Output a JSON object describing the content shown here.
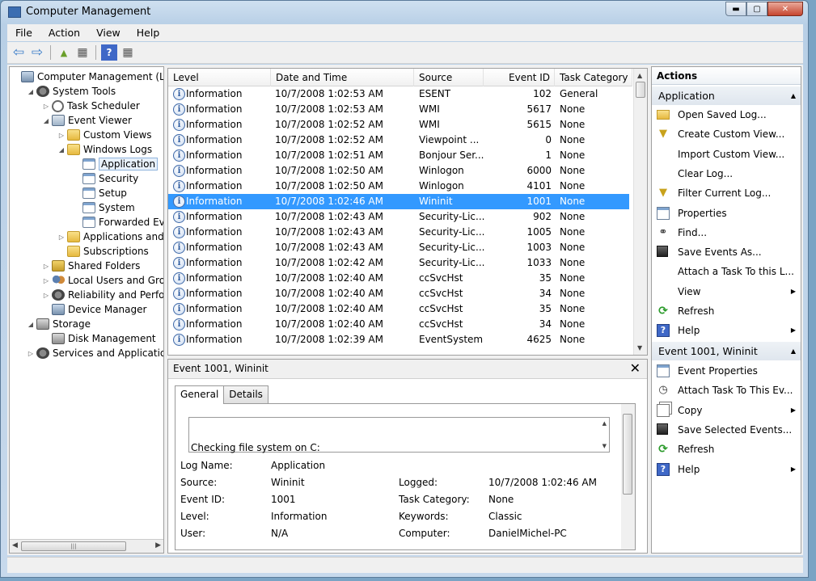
{
  "window": {
    "title": "Computer Management"
  },
  "menu": [
    "File",
    "Action",
    "View",
    "Help"
  ],
  "toolbar": [
    {
      "icon": "back-arrow-icon",
      "glyph": "⇦"
    },
    {
      "icon": "forward-arrow-icon",
      "glyph": "⇨"
    },
    {
      "icon": "up-folder-icon",
      "glyph": "▲"
    },
    {
      "icon": "show-hide-tree-icon",
      "glyph": "▦"
    },
    {
      "icon": "help-icon",
      "glyph": "?"
    },
    {
      "icon": "show-hide-action-pane-icon",
      "glyph": "▦"
    }
  ],
  "tree": [
    {
      "label": "Computer Management (Local)",
      "indent": 0,
      "exp": "",
      "icon": "comp",
      "icon_name": "computer-management-icon"
    },
    {
      "label": "System Tools",
      "indent": 1,
      "exp": "◢",
      "icon": "gear",
      "icon_name": "system-tools-icon"
    },
    {
      "label": "Task Scheduler",
      "indent": 2,
      "exp": "▷",
      "icon": "clock",
      "icon_name": "task-scheduler-icon"
    },
    {
      "label": "Event Viewer",
      "indent": 2,
      "exp": "◢",
      "icon": "event",
      "icon_name": "event-viewer-icon"
    },
    {
      "label": "Custom Views",
      "indent": 3,
      "exp": "▷",
      "icon": "folder",
      "icon_name": "folder-icon"
    },
    {
      "label": "Windows Logs",
      "indent": 3,
      "exp": "◢",
      "icon": "folder",
      "icon_name": "folder-icon"
    },
    {
      "label": "Application",
      "indent": 4,
      "exp": "",
      "icon": "log",
      "icon_name": "log-icon",
      "selected": true
    },
    {
      "label": "Security",
      "indent": 4,
      "exp": "",
      "icon": "log",
      "icon_name": "log-icon"
    },
    {
      "label": "Setup",
      "indent": 4,
      "exp": "",
      "icon": "log",
      "icon_name": "log-icon"
    },
    {
      "label": "System",
      "indent": 4,
      "exp": "",
      "icon": "log",
      "icon_name": "log-icon"
    },
    {
      "label": "Forwarded Events",
      "indent": 4,
      "exp": "",
      "icon": "log",
      "icon_name": "log-icon"
    },
    {
      "label": "Applications and Servic",
      "indent": 3,
      "exp": "▷",
      "icon": "folder",
      "icon_name": "folder-icon"
    },
    {
      "label": "Subscriptions",
      "indent": 3,
      "exp": "",
      "icon": "folder",
      "icon_name": "subscriptions-icon"
    },
    {
      "label": "Shared Folders",
      "indent": 2,
      "exp": "▷",
      "icon": "share",
      "icon_name": "shared-folders-icon"
    },
    {
      "label": "Local Users and Groups",
      "indent": 2,
      "exp": "▷",
      "icon": "people",
      "icon_name": "users-groups-icon"
    },
    {
      "label": "Reliability and Performanc",
      "indent": 2,
      "exp": "▷",
      "icon": "gear",
      "icon_name": "reliability-icon"
    },
    {
      "label": "Device Manager",
      "indent": 2,
      "exp": "",
      "icon": "comp",
      "icon_name": "device-manager-icon"
    },
    {
      "label": "Storage",
      "indent": 1,
      "exp": "◢",
      "icon": "disk",
      "icon_name": "storage-icon"
    },
    {
      "label": "Disk Management",
      "indent": 2,
      "exp": "",
      "icon": "disk",
      "icon_name": "disk-management-icon"
    },
    {
      "label": "Services and Applications",
      "indent": 1,
      "exp": "▷",
      "icon": "gear",
      "icon_name": "services-applications-icon"
    }
  ],
  "events": {
    "columns": [
      "Level",
      "Date and Time",
      "Source",
      "Event ID",
      "Task Category"
    ],
    "rows": [
      {
        "level": "Information",
        "date": "10/7/2008 1:02:53 AM",
        "source": "ESENT",
        "id": "102",
        "category": "General"
      },
      {
        "level": "Information",
        "date": "10/7/2008 1:02:53 AM",
        "source": "WMI",
        "id": "5617",
        "category": "None"
      },
      {
        "level": "Information",
        "date": "10/7/2008 1:02:52 AM",
        "source": "WMI",
        "id": "5615",
        "category": "None"
      },
      {
        "level": "Information",
        "date": "10/7/2008 1:02:52 AM",
        "source": "Viewpoint ...",
        "id": "0",
        "category": "None"
      },
      {
        "level": "Information",
        "date": "10/7/2008 1:02:51 AM",
        "source": "Bonjour Ser...",
        "id": "1",
        "category": "None"
      },
      {
        "level": "Information",
        "date": "10/7/2008 1:02:50 AM",
        "source": "Winlogon",
        "id": "6000",
        "category": "None"
      },
      {
        "level": "Information",
        "date": "10/7/2008 1:02:50 AM",
        "source": "Winlogon",
        "id": "4101",
        "category": "None"
      },
      {
        "level": "Information",
        "date": "10/7/2008 1:02:46 AM",
        "source": "Wininit",
        "id": "1001",
        "category": "None",
        "selected": true
      },
      {
        "level": "Information",
        "date": "10/7/2008 1:02:43 AM",
        "source": "Security-Lic...",
        "id": "902",
        "category": "None"
      },
      {
        "level": "Information",
        "date": "10/7/2008 1:02:43 AM",
        "source": "Security-Lic...",
        "id": "1005",
        "category": "None"
      },
      {
        "level": "Information",
        "date": "10/7/2008 1:02:43 AM",
        "source": "Security-Lic...",
        "id": "1003",
        "category": "None"
      },
      {
        "level": "Information",
        "date": "10/7/2008 1:02:42 AM",
        "source": "Security-Lic...",
        "id": "1033",
        "category": "None"
      },
      {
        "level": "Information",
        "date": "10/7/2008 1:02:40 AM",
        "source": "ccSvcHst",
        "id": "35",
        "category": "None"
      },
      {
        "level": "Information",
        "date": "10/7/2008 1:02:40 AM",
        "source": "ccSvcHst",
        "id": "34",
        "category": "None"
      },
      {
        "level": "Information",
        "date": "10/7/2008 1:02:40 AM",
        "source": "ccSvcHst",
        "id": "35",
        "category": "None"
      },
      {
        "level": "Information",
        "date": "10/7/2008 1:02:40 AM",
        "source": "ccSvcHst",
        "id": "34",
        "category": "None"
      },
      {
        "level": "Information",
        "date": "10/7/2008 1:02:39 AM",
        "source": "EventSystem",
        "id": "4625",
        "category": "None"
      }
    ],
    "info_glyph": "i"
  },
  "detail": {
    "title": "Event 1001, Wininit",
    "close_glyph": "✕",
    "tabs": [
      "General",
      "Details"
    ],
    "message": "Checking file system on C:",
    "labels": {
      "log_name": "Log Name:",
      "source": "Source:",
      "event_id": "Event ID:",
      "level": "Level:",
      "user": "User:",
      "logged": "Logged:",
      "task_category": "Task Category:",
      "keywords": "Keywords:",
      "computer": "Computer:"
    },
    "values": {
      "log_name": "Application",
      "source": "Wininit",
      "event_id": "1001",
      "level": "Information",
      "user": "N/A",
      "logged": "10/7/2008 1:02:46 AM",
      "task_category": "None",
      "keywords": "Classic",
      "computer": "DanielMichel-PC"
    }
  },
  "actions": {
    "title": "Actions",
    "section1": "Application",
    "items1": [
      {
        "label": "Open Saved Log...",
        "icon": "folder",
        "icon_name": "open-folder-icon",
        "glyph": ""
      },
      {
        "label": "Create Custom View...",
        "icon": "funnel",
        "icon_name": "funnel-icon",
        "glyph": "▼"
      },
      {
        "label": "Import Custom View...",
        "icon": "",
        "icon_name": "",
        "glyph": ""
      },
      {
        "label": "Clear Log...",
        "icon": "",
        "icon_name": "",
        "glyph": ""
      },
      {
        "label": "Filter Current Log...",
        "icon": "funnel",
        "icon_name": "filter-icon",
        "glyph": "▼"
      },
      {
        "label": "Properties",
        "icon": "props",
        "icon_name": "properties-icon",
        "glyph": ""
      },
      {
        "label": "Find...",
        "icon": "find",
        "icon_name": "binoculars-icon",
        "glyph": "⚭"
      },
      {
        "label": "Save Events As...",
        "icon": "disk",
        "icon_name": "save-icon",
        "glyph": ""
      },
      {
        "label": "Attach a Task To this L...",
        "icon": "",
        "icon_name": "",
        "glyph": ""
      },
      {
        "label": "View",
        "icon": "",
        "icon_name": "",
        "glyph": "",
        "submenu": true
      },
      {
        "label": "Refresh",
        "icon": "refresh",
        "icon_name": "refresh-icon",
        "glyph": "⟳"
      },
      {
        "label": "Help",
        "icon": "help",
        "icon_name": "help-icon",
        "glyph": "?",
        "submenu": true
      }
    ],
    "section2": "Event 1001, Wininit",
    "items2": [
      {
        "label": "Event Properties",
        "icon": "props",
        "icon_name": "event-properties-icon",
        "glyph": ""
      },
      {
        "label": "Attach Task To This Ev...",
        "icon": "find",
        "icon_name": "task-clock-icon",
        "glyph": "◷"
      },
      {
        "label": "Copy",
        "icon": "copy",
        "icon_name": "copy-icon",
        "glyph": "",
        "submenu": true
      },
      {
        "label": "Save Selected Events...",
        "icon": "disk",
        "icon_name": "save-icon",
        "glyph": ""
      },
      {
        "label": "Refresh",
        "icon": "refresh",
        "icon_name": "refresh-icon",
        "glyph": "⟳"
      },
      {
        "label": "Help",
        "icon": "help",
        "icon_name": "help-icon",
        "glyph": "?",
        "submenu": true
      }
    ],
    "collapse_glyph": "▲",
    "submenu_glyph": "▶"
  },
  "window_buttons": {
    "minimize": "▬",
    "maximize": "▢",
    "close": "✕"
  }
}
